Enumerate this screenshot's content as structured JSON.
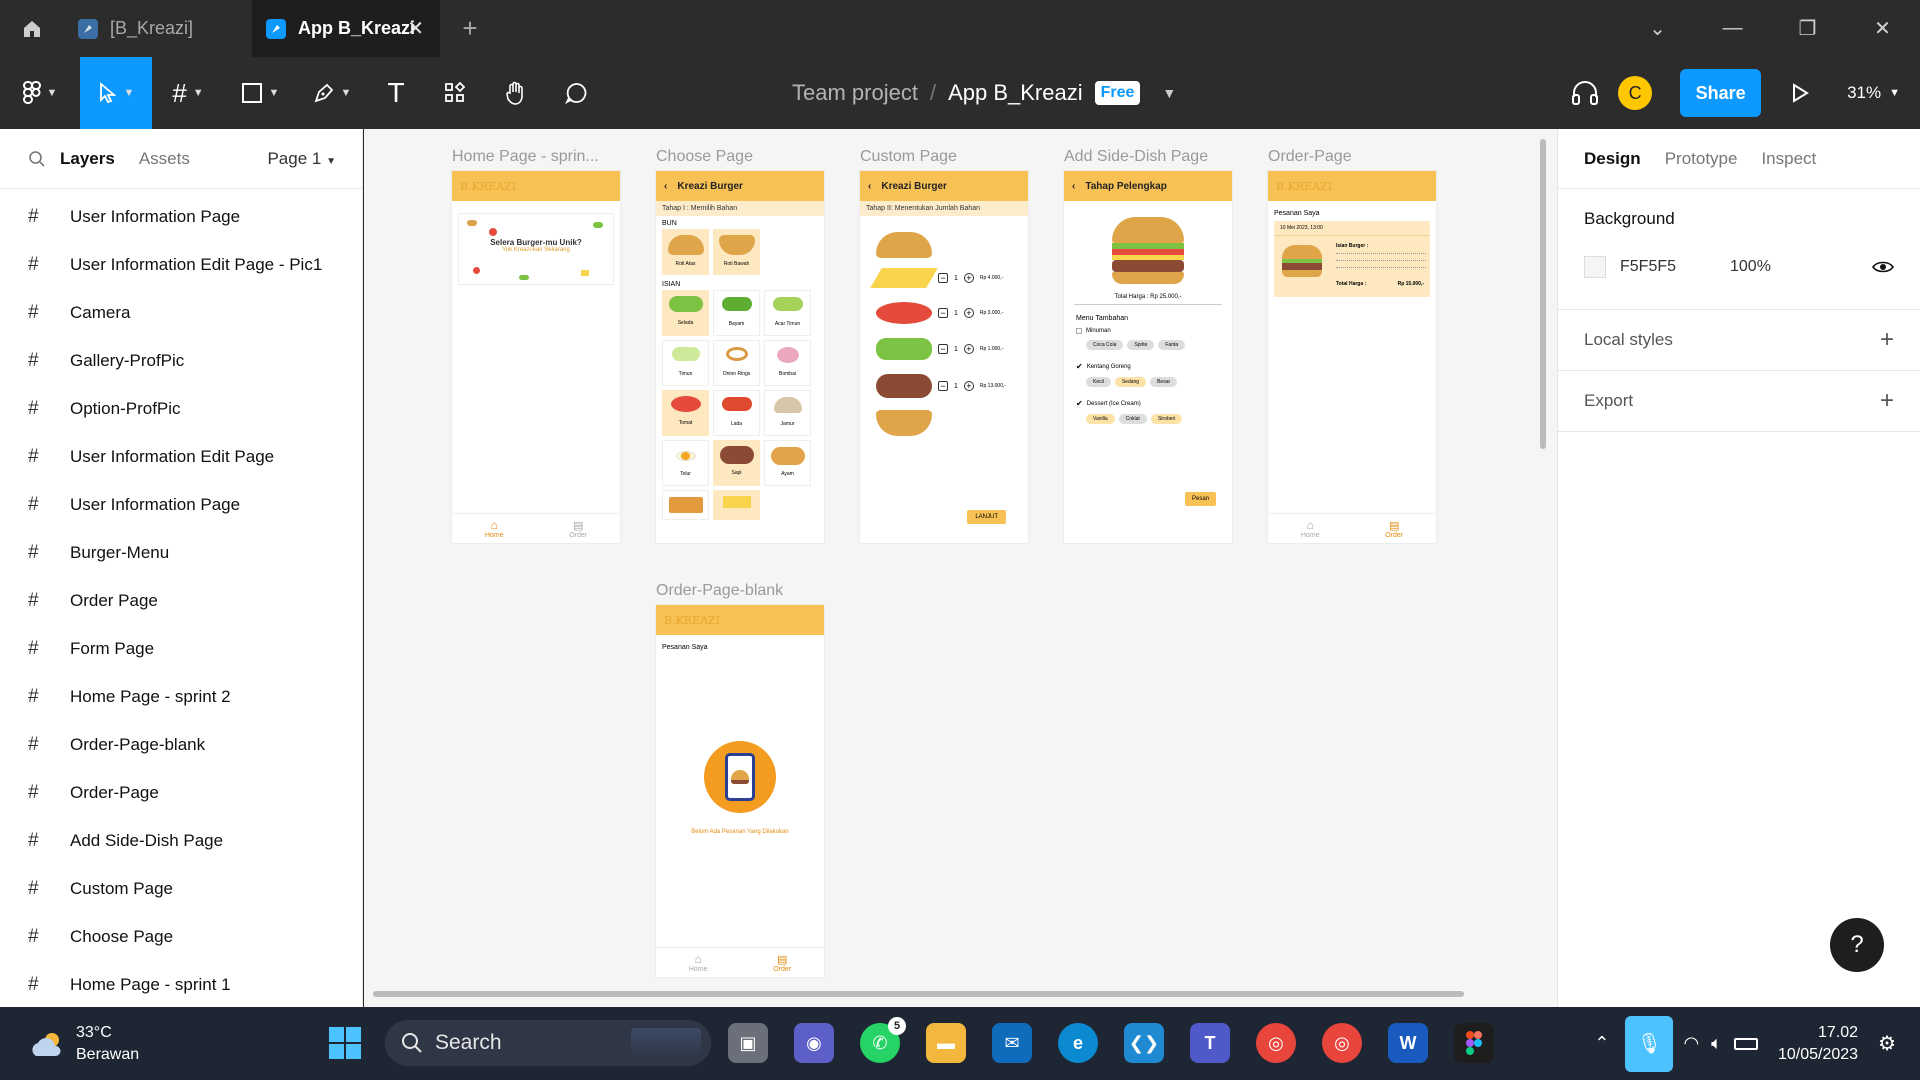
{
  "tabs": [
    {
      "label": "[B_Kreazi]",
      "active": false
    },
    {
      "label": "App B_Kreazi",
      "active": true
    }
  ],
  "toolbar": {
    "team": "Team project",
    "separator": "/",
    "file_name": "App B_Kreazi",
    "plan_badge": "Free",
    "avatar_initial": "C",
    "share_label": "Share",
    "zoom": "31%"
  },
  "left_panel": {
    "tab_layers": "Layers",
    "tab_assets": "Assets",
    "page": "Page 1",
    "layers": [
      "User Information Page",
      "User Information Edit Page - Pic1",
      "Camera",
      "Gallery-ProfPic",
      "Option-ProfPic",
      "User Information Edit Page",
      "User Information Page",
      "Burger-Menu",
      "Order Page",
      "Form Page",
      "Home Page - sprint 2",
      "Order-Page-blank",
      "Order-Page",
      "Add Side-Dish Page",
      "Custom Page",
      "Choose Page",
      "Home Page - sprint 1"
    ]
  },
  "canvas": {
    "frames": {
      "home": {
        "label": "Home Page - sprin...",
        "banner_title": "Selera Burger-mu Unik?",
        "banner_sub": "Yuk Kreazi-kan Sekarang",
        "nav_home": "Home",
        "nav_order": "Order"
      },
      "choose": {
        "label": "Choose Page",
        "header": "Kreazi Burger",
        "step": "Tahap I : Memilih Bahan",
        "bun_label": "BUN",
        "isian_label": "ISIAN",
        "buns": [
          "Roti Atas",
          "Roti Bawah"
        ],
        "fillings": [
          "Selada",
          "Bayam",
          "Acar Timun",
          "Timun",
          "Onion Rings",
          "Bombai",
          "Tomat",
          "Lada",
          "Jamur",
          "Telur",
          "Sapi",
          "Ayam"
        ]
      },
      "custom": {
        "label": "Custom Page",
        "header": "Kreazi Burger",
        "step": "Tahap II: Menentukan Jumlah Bahan",
        "prices": [
          "Rp 4.000,-",
          "Rp 3.000,-",
          "Rp 1.000,-",
          "Rp 13.000,-"
        ],
        "qty": "1",
        "button": "LANJUT"
      },
      "side": {
        "label": "Add Side-Dish Page",
        "header": "Tahap Pelengkap",
        "total": "Total Harga : Rp 25.000,-",
        "menu_title": "Menu Tambahan",
        "groups": [
          {
            "name": "Minuman",
            "options": [
              "Coca Cola",
              "Sprite",
              "Fanta"
            ]
          },
          {
            "name": "Kentang Goreng",
            "options": [
              "Kecil",
              "Sedang",
              "Besar"
            ]
          },
          {
            "name": "Dessert (Ice Cream)",
            "options": [
              "Vanilla",
              "Coklat",
              "Stroberi"
            ]
          }
        ],
        "button": "Pesan"
      },
      "order": {
        "label": "Order-Page",
        "title": "Pesanan Saya",
        "date": "10 Mei 2023, 13:00",
        "card_title": "Isian Burger :",
        "total": "Total Harga :",
        "total_value": "Rp 15.000,-"
      },
      "blank": {
        "label": "Order-Page-blank",
        "title": "Pesanan Saya",
        "empty": "Belum Ada Pesanan Yang Dilakukan"
      }
    }
  },
  "right_panel": {
    "tab_design": "Design",
    "tab_prototype": "Prototype",
    "tab_inspect": "Inspect",
    "background_title": "Background",
    "background_hex": "F5F5F5",
    "background_opacity": "100%",
    "local_styles": "Local styles",
    "export": "Export",
    "help": "?"
  },
  "taskbar": {
    "temperature": "33°C",
    "weather": "Berawan",
    "search_placeholder": "Search",
    "whatsapp_badge": "5",
    "time": "17.02",
    "date": "10/05/2023"
  },
  "colors": {
    "accent": "#0d99ff",
    "app_header": "#f8c155",
    "canvas_bg": "#f5f5f5"
  }
}
